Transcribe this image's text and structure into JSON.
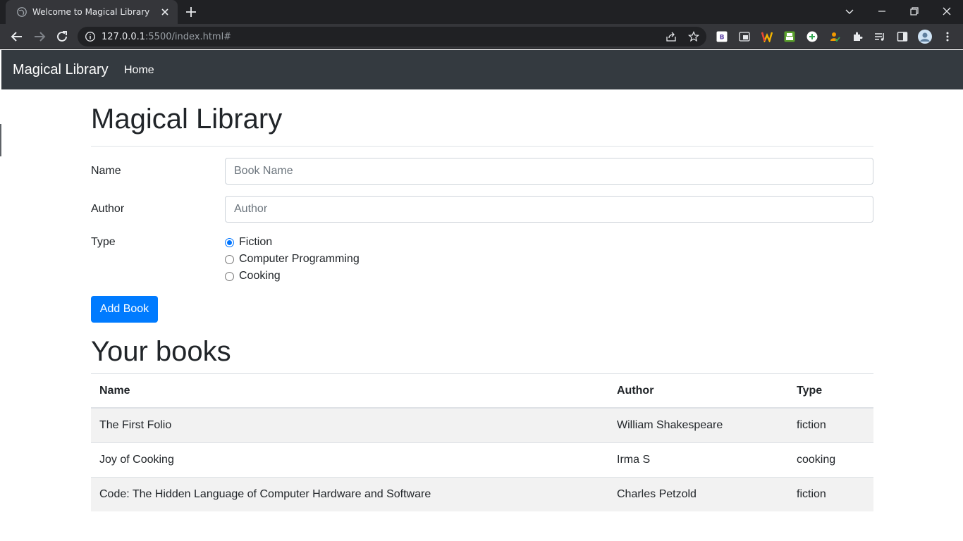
{
  "browser": {
    "tab_title": "Welcome to Magical Library",
    "url_host": "127.0.0.1",
    "url_rest": ":5500/index.html#"
  },
  "navbar": {
    "brand": "Magical Library",
    "home_link": "Home"
  },
  "form": {
    "title": "Magical Library",
    "name_label": "Name",
    "name_placeholder": "Book Name",
    "author_label": "Author",
    "author_placeholder": "Author",
    "type_label": "Type",
    "type_options": [
      {
        "label": "Fiction",
        "checked": true
      },
      {
        "label": "Computer Programming",
        "checked": false
      },
      {
        "label": "Cooking",
        "checked": false
      }
    ],
    "submit_label": "Add Book"
  },
  "books": {
    "title": "Your books",
    "columns": [
      "Name",
      "Author",
      "Type"
    ],
    "rows": [
      [
        "The First Folio",
        "William Shakespeare",
        "fiction"
      ],
      [
        "Joy of Cooking",
        "Irma S",
        "cooking"
      ],
      [
        "Code: The Hidden Language of Computer Hardware and Software",
        "Charles Petzold",
        "fiction"
      ]
    ]
  },
  "colors": {
    "navbar_bg": "#343a40",
    "primary": "#007bff",
    "radio_accent": "#0075ff",
    "striped_row": "#f2f2f2"
  }
}
